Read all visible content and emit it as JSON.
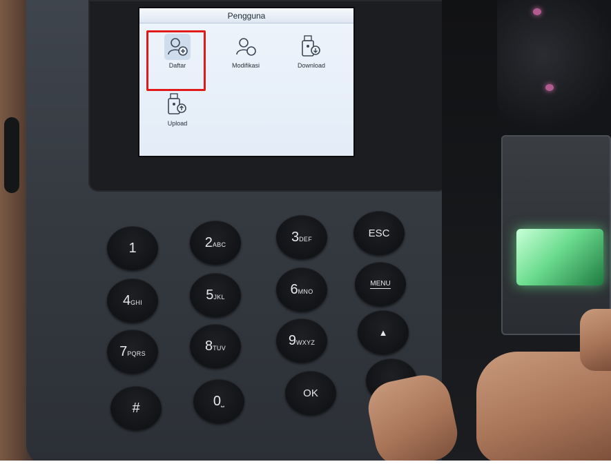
{
  "screen": {
    "title": "Pengguna",
    "items": [
      {
        "label": "Daftar",
        "icon": "user-add-icon"
      },
      {
        "label": "Modifikasi",
        "icon": "user-edit-icon"
      },
      {
        "label": "Download",
        "icon": "usb-download-icon"
      },
      {
        "label": "Upload",
        "icon": "usb-upload-icon"
      }
    ],
    "highlight_color": "#e01919"
  },
  "keypad": {
    "keys": [
      {
        "main": "1",
        "sub": ""
      },
      {
        "main": "2",
        "sub": "ABC"
      },
      {
        "main": "3",
        "sub": "DEF"
      },
      {
        "main": "ESC",
        "sub": ""
      },
      {
        "main": "4",
        "sub": "GHI"
      },
      {
        "main": "5",
        "sub": "JKL"
      },
      {
        "main": "6",
        "sub": "MNO"
      },
      {
        "main": "MENU",
        "sub": ""
      },
      {
        "main": "7",
        "sub": "PQRS"
      },
      {
        "main": "8",
        "sub": "TUV"
      },
      {
        "main": "9",
        "sub": "WXYZ"
      },
      {
        "main": "▲",
        "sub": ""
      },
      {
        "main": "#",
        "sub": ""
      },
      {
        "main": "0",
        "sub": "⎵"
      },
      {
        "main": "OK",
        "sub": ""
      },
      {
        "main": "",
        "sub": ""
      }
    ]
  },
  "colors": {
    "fingerprint_glow": "#6bdc8e",
    "led": "#b25b90"
  }
}
